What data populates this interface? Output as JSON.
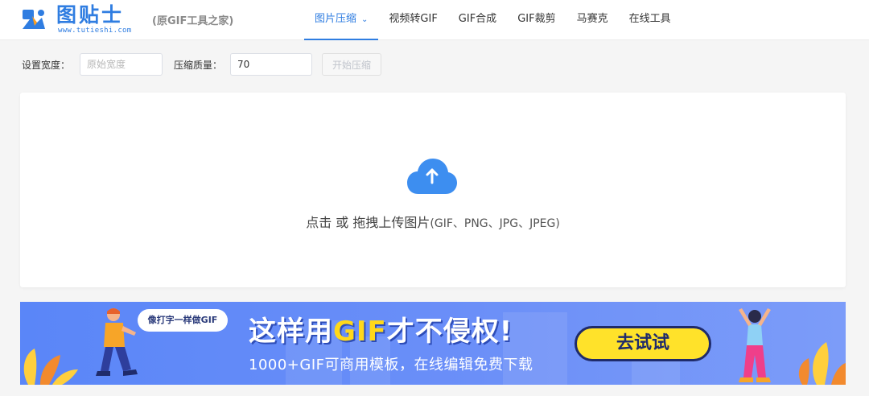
{
  "brand": {
    "name": "图贴士",
    "url": "www.tutieshi.com",
    "slogan": "(原GIF工具之家)"
  },
  "nav": {
    "items": [
      {
        "label": "图片压缩",
        "active": true
      },
      {
        "label": "视频转GIF"
      },
      {
        "label": "GIF合成"
      },
      {
        "label": "GIF裁剪"
      },
      {
        "label": "马赛克"
      },
      {
        "label": "在线工具"
      }
    ]
  },
  "toolbar": {
    "width_label": "设置宽度：",
    "width_placeholder": "原始宽度",
    "quality_label": "压缩质量：",
    "quality_value": "70",
    "start_label": "开始压缩"
  },
  "upload": {
    "text": "点击 或 拖拽上传图片",
    "formats": "(GIF、PNG、JPG、JPEG)"
  },
  "banner": {
    "bubble": "像打字一样做GIF",
    "headline_pre": "这样用",
    "headline_gif": "GIF",
    "headline_post": "才不侵权!",
    "subline": "1000+GIF可商用模板，在线编辑免费下载",
    "cta": "去试试"
  },
  "colors": {
    "primary": "#2f7de1",
    "banner_bg": "#6b8ff8",
    "cta_bg": "#ffe22a",
    "headline_accent": "#ffd81a"
  }
}
